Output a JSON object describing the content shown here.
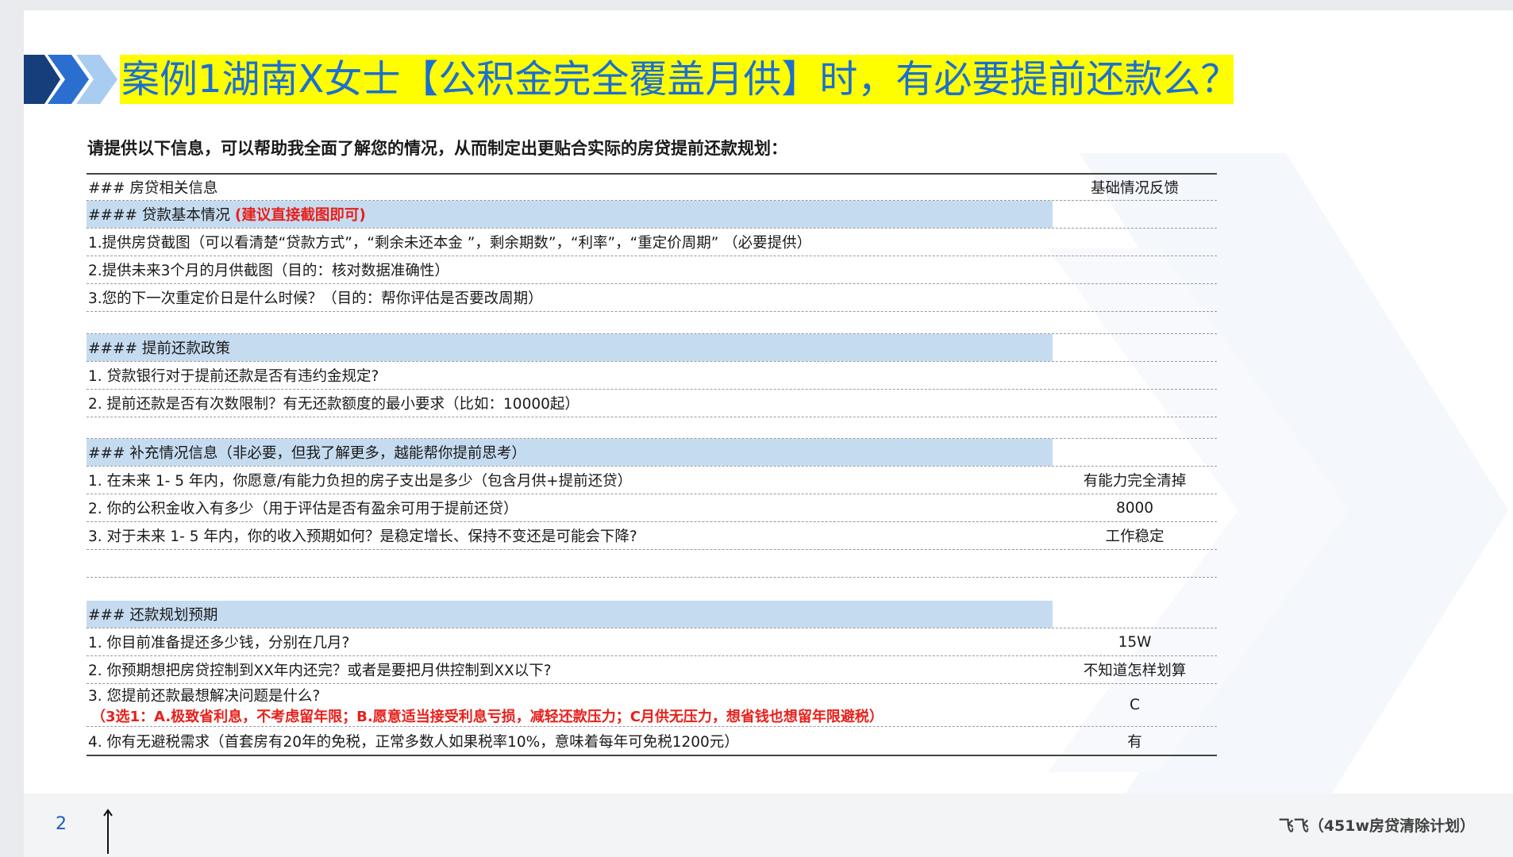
{
  "title": "案例1湖南X女士【公积金完全覆盖月供】时，有必要提前还款么？",
  "subtitle": "请提供以下信息，可以帮助我全面了解您的情况，从而制定出更贴合实际的房贷提前还款规划：",
  "table": {
    "header": {
      "left": "### 房贷相关信息",
      "right": "基础情况反馈"
    },
    "section1": {
      "heading": "#### 贷款基本情况",
      "heading_note": "(建议直接截图即可)",
      "rows": [
        {
          "q": "1.提供房贷截图（可以看清楚“贷款方式”，“剩余未还本金 ”，剩余期数”，“利率”，“重定价周期” （必要提供）",
          "a": ""
        },
        {
          "q": "2.提供未来3个月的月供截图（目的：核对数据准确性）",
          "a": ""
        },
        {
          "q": "3.您的下一次重定价日是什么时候？（目的：帮你评估是否要改周期）",
          "a": ""
        }
      ]
    },
    "section2": {
      "heading": "#### 提前还款政策",
      "rows": [
        {
          "q": "1. 贷款银行对于提前还款是否有违约金规定?",
          "a": ""
        },
        {
          "q": "2. 提前还款是否有次数限制？有无还款额度的最小要求（比如：10000起）",
          "a": ""
        }
      ]
    },
    "section3": {
      "heading": "### 补充情况信息（非必要，但我了解更多，越能帮你提前思考）",
      "rows": [
        {
          "q": "1. 在未来 1- 5 年内，你愿意/有能力负担的房子支出是多少（包含月供+提前还贷）",
          "a": "有能力完全清掉"
        },
        {
          "q": "2. 你的公积金收入有多少（用于评估是否有盈余可用于提前还贷）",
          "a": "8000"
        },
        {
          "q": "3. 对于未来 1- 5 年内，你的收入预期如何？是稳定增长、保持不变还是可能会下降?",
          "a": "工作稳定"
        }
      ]
    },
    "section4": {
      "heading": "### 还款规划预期",
      "rows": [
        {
          "q": "1. 你目前准备提还多少钱，分别在几月?",
          "a": "15W"
        },
        {
          "q": "2. 你预期想把房贷控制到XX年内还完？或者是要把月供控制到XX以下?",
          "a": "不知道怎样划算"
        },
        {
          "q": "3. 您提前还款最想解决问题是什么?",
          "q_note": "（3选1：A.极致省利息，不考虑留年限；B.愿意适当接受利息亏损，减轻还款压力；C月供无压力，想省钱也想留年限避税）",
          "a": "C"
        },
        {
          "q": "4. 你有无避税需求（首套房有20年的免税，正常多数人如果税率10%，意味着每年可免税1200元）",
          "a": "有"
        }
      ]
    }
  },
  "footer": {
    "page_number": "2",
    "author": "飞飞（451w房贷清除计划）"
  },
  "colors": {
    "title_text": "#1c6fd0",
    "title_bg": "#fefe00",
    "row_highlight": "#c5dbf0",
    "note_red": "#e8201b",
    "chevron": "#1f5fb5"
  }
}
